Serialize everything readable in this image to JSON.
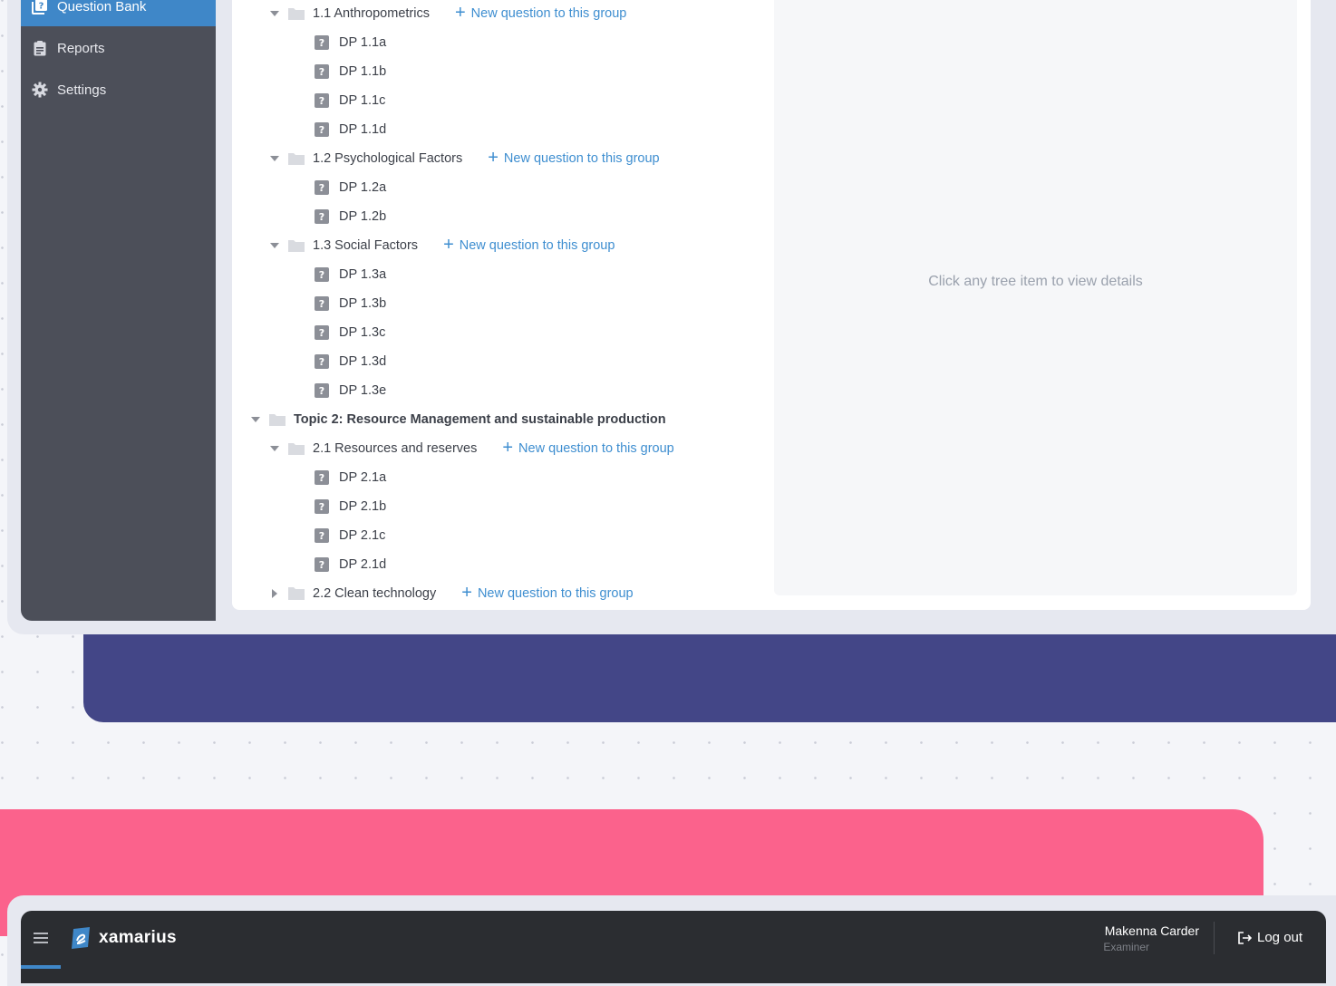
{
  "sidebar": {
    "items": [
      {
        "label": "Question Bank",
        "icon": "question-bank-icon",
        "active": true
      },
      {
        "label": "Reports",
        "icon": "clipboard-icon",
        "active": false
      },
      {
        "label": "Settings",
        "icon": "gear-icon",
        "active": false
      }
    ]
  },
  "tree": {
    "add_label": "New question to this group",
    "groups": {
      "g11": {
        "label": "1.1 Anthropometrics",
        "items": [
          "DP 1.1a",
          "DP 1.1b",
          "DP 1.1c",
          "DP 1.1d"
        ]
      },
      "g12": {
        "label": "1.2 Psychological Factors",
        "items": [
          "DP 1.2a",
          "DP 1.2b"
        ]
      },
      "g13": {
        "label": "1.3 Social Factors",
        "items": [
          "DP 1.3a",
          "DP 1.3b",
          "DP 1.3c",
          "DP 1.3d",
          "DP 1.3e"
        ]
      },
      "topic2": {
        "label": "Topic 2: Resource Management and sustainable production"
      },
      "g21": {
        "label": "2.1 Resources and reserves",
        "items": [
          "DP 2.1a",
          "DP 2.1b",
          "DP 2.1c",
          "DP 2.1d"
        ]
      },
      "g22": {
        "label": "2.2 Clean technology",
        "collapsed": true
      }
    }
  },
  "detail": {
    "placeholder": "Click any tree item to view details"
  },
  "header": {
    "brand": "xamarius",
    "user_name": "Makenna Carder",
    "user_role": "Examiner",
    "logout_label": "Log out"
  },
  "colors": {
    "accent": "#3f87c8",
    "link": "#3e8ed0",
    "sidebar_bg": "#4c4f59",
    "purple_band": "#434687",
    "pink_band": "#fb628c",
    "topbar_bg": "#2b2d31"
  }
}
